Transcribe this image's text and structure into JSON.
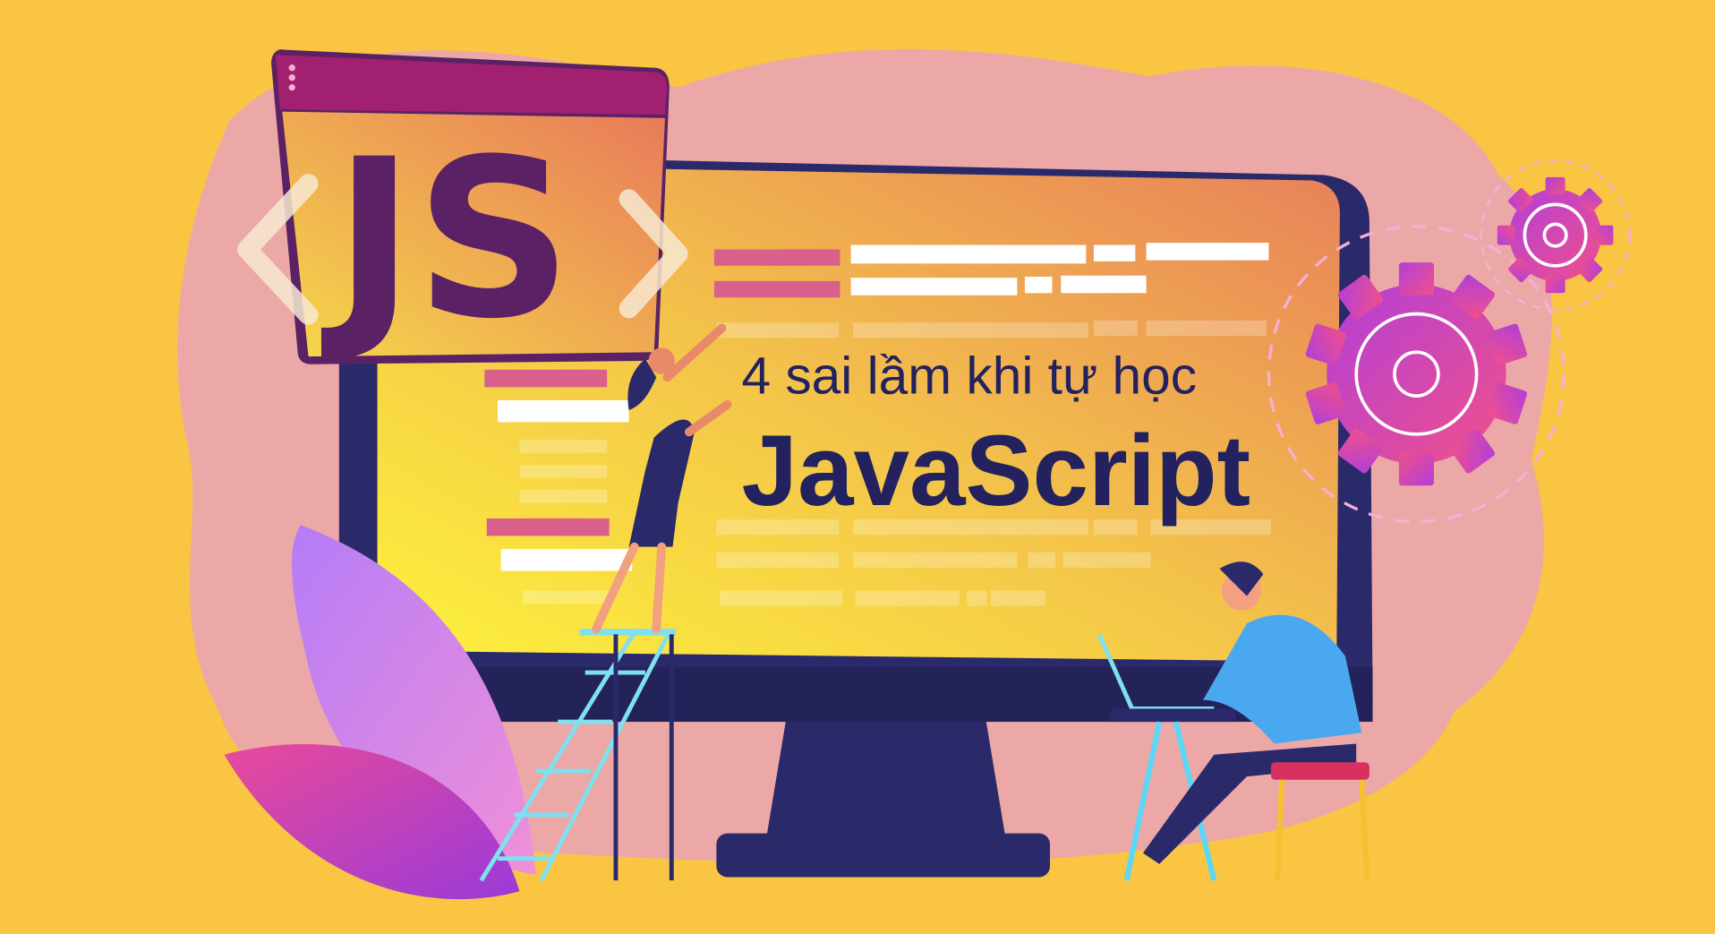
{
  "banner": {
    "subtitle": "4 sai lầm khi tự học",
    "title": "JavaScript",
    "logo_text": "JS",
    "colors": {
      "background": "#F9C543",
      "text": "#23225F",
      "monitor": "#2A2A6A",
      "gear": "#D33FA8",
      "js_header": "#A22070"
    }
  }
}
